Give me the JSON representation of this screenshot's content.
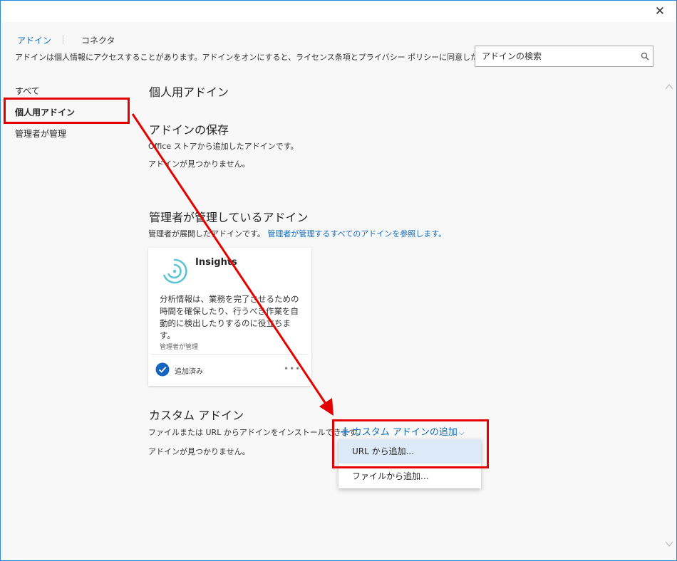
{
  "window": {
    "close_glyph": "✕"
  },
  "tabs": [
    {
      "label": "アドイン",
      "active": true
    },
    {
      "label": "コネクタ",
      "active": false
    }
  ],
  "disclaimer": "アドインは個人情報にアクセスすることがあります。アドインをオンにすると、ライセンス条項とプライバシー ポリシーに同意したことになります。",
  "search": {
    "placeholder": "アドインの検索",
    "icon": "search-icon"
  },
  "sidebar": {
    "items": [
      {
        "label": "すべて",
        "selected": false
      },
      {
        "label": "個人用アドイン",
        "selected": true
      },
      {
        "label": "管理者が管理",
        "selected": false
      }
    ]
  },
  "main": {
    "title": "個人用アドイン",
    "saved": {
      "title": "アドインの保存",
      "description": "Office ストアから追加したアドインです。",
      "empty": "アドインが見つかりません。"
    },
    "admin": {
      "title": "管理者が管理しているアドイン",
      "description": "管理者が展開したアドインです。",
      "link": "管理者が管理するすべてのアドインを参照します。",
      "card": {
        "name": "Insights",
        "description": "分析情報は、業務を完了させるための時間を確保したり、行うべき作業を自動的に検出したりするのに役立ちます。",
        "managed_label": "管理者が管理",
        "status": "追加済み",
        "more": "•••",
        "brand_color": "#5ec4d4"
      }
    },
    "custom": {
      "title": "カスタム アドイン",
      "description": "ファイルまたは URL からアドインをインストールできます。",
      "empty": "アドインが見つかりません。",
      "add_button": {
        "plus": "+",
        "label": "カスタム アドインの追加",
        "chevron": "⌵"
      },
      "menu": [
        {
          "label": "URL から追加...",
          "highlighted": true
        },
        {
          "label": "ファイルから追加...",
          "highlighted": false
        }
      ]
    }
  },
  "colors": {
    "accent": "#106ebe",
    "annotation": "#e50000",
    "check": "#1565c0"
  }
}
